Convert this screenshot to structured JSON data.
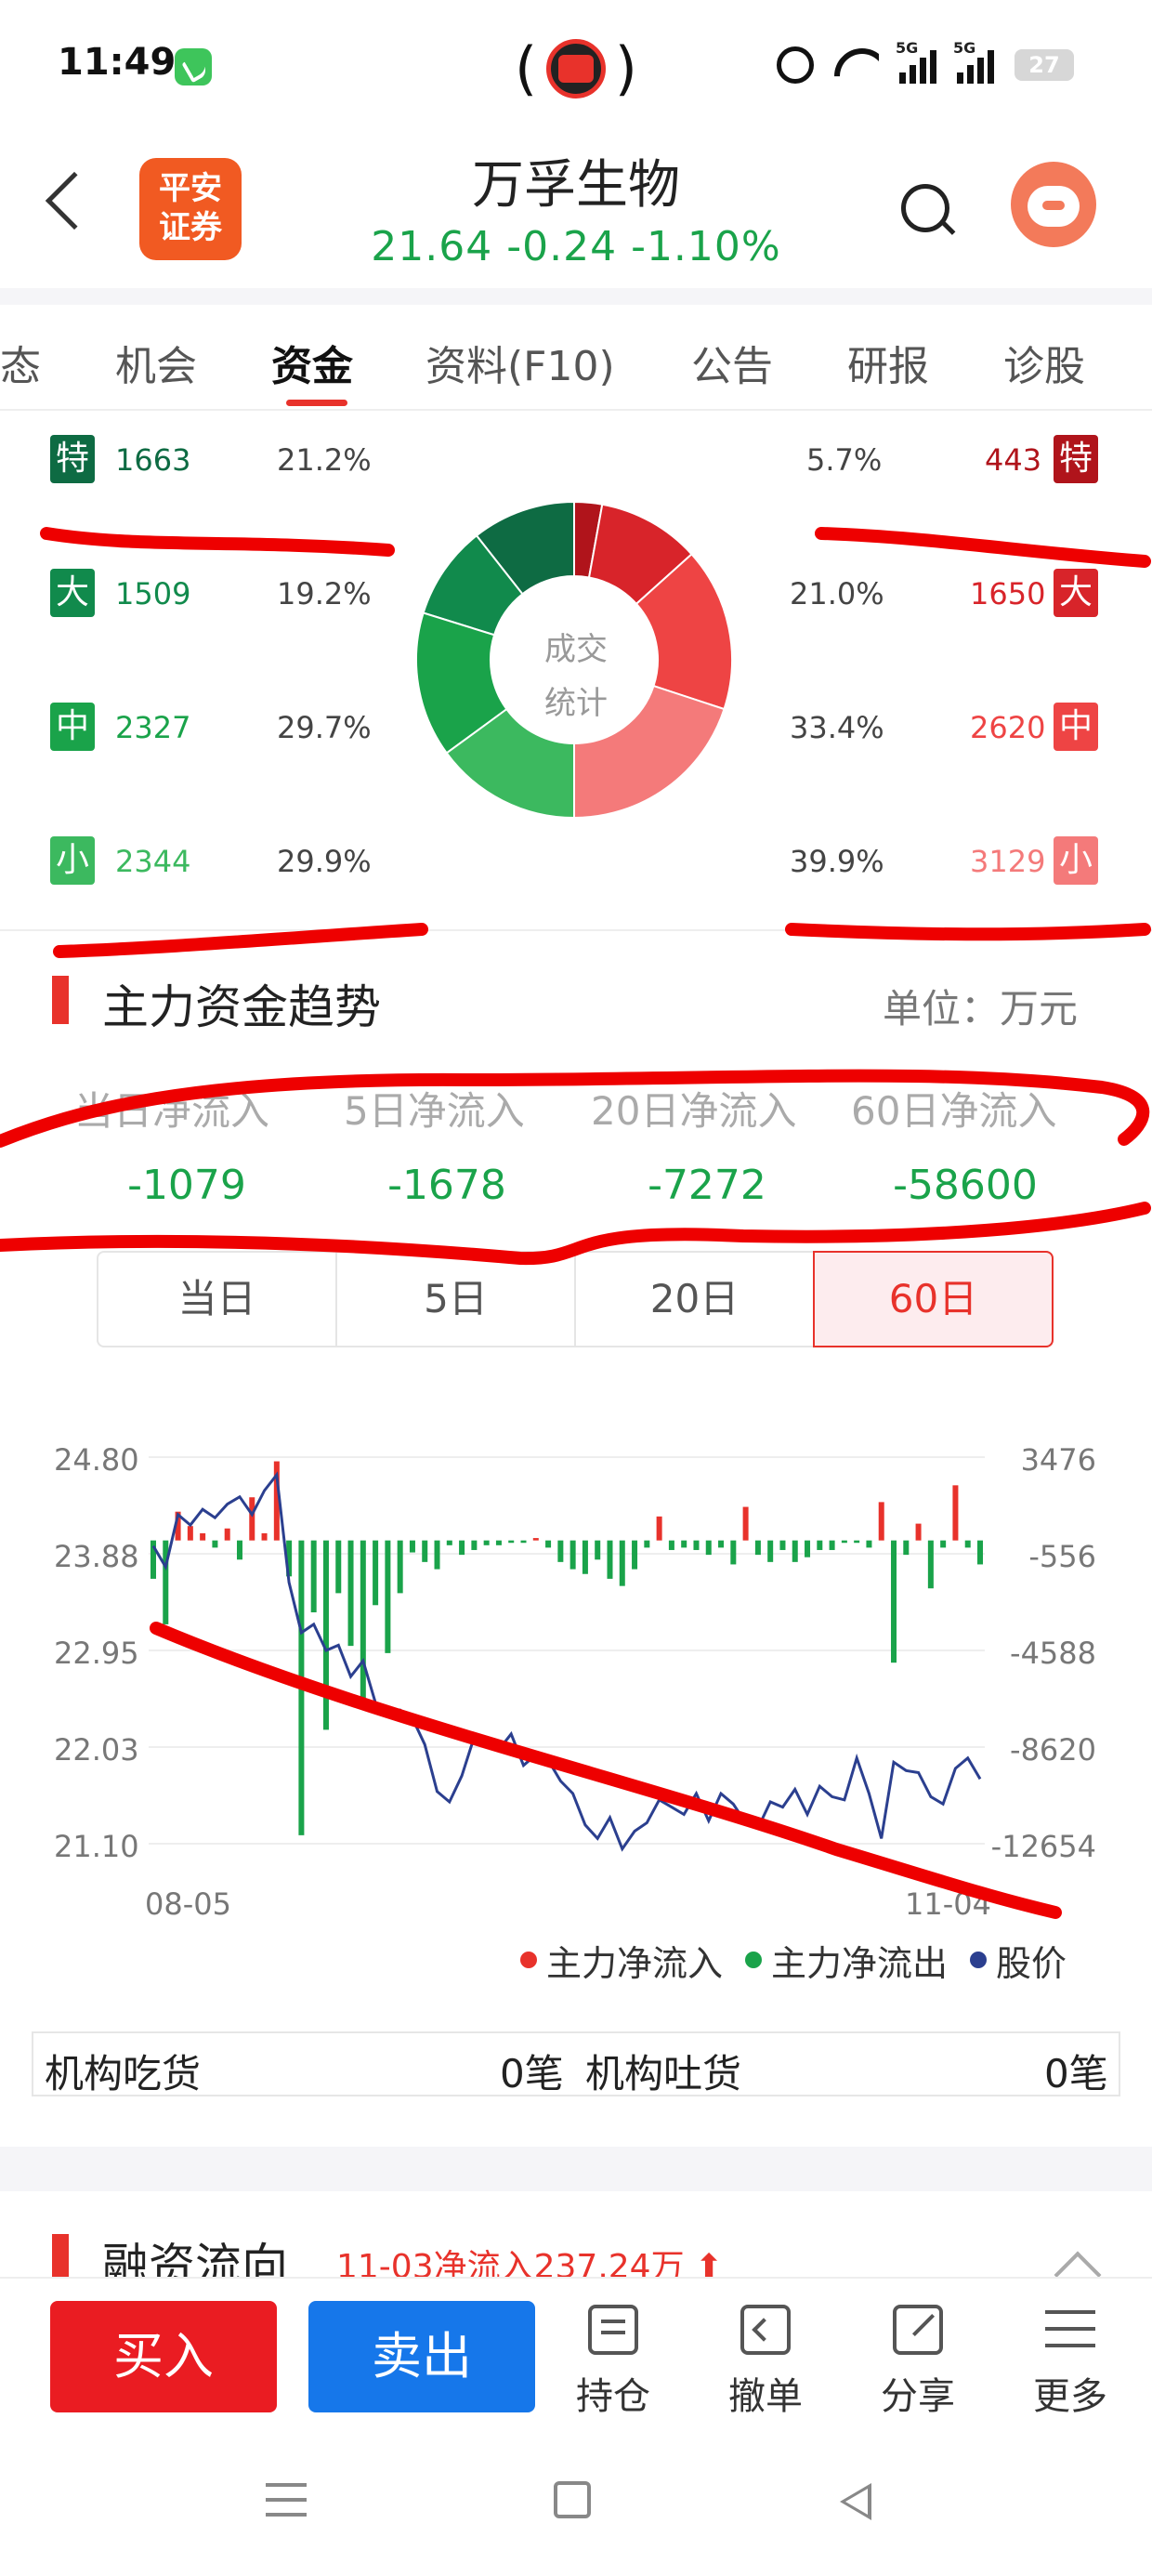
{
  "status_bar": {
    "time": "11:49",
    "center_glyph_left": "(",
    "center_glyph_right": ")",
    "signal_1": "5G",
    "signal_2": "5G",
    "battery": "27"
  },
  "header": {
    "broker_logo": "平安证券",
    "stock_name": "万孚生物",
    "quote": "21.64  -0.24  -1.10%"
  },
  "tabs": [
    {
      "label": "态"
    },
    {
      "label": "机会"
    },
    {
      "label": "资金"
    },
    {
      "label": "资料(F10)"
    },
    {
      "label": "公告"
    },
    {
      "label": "研报"
    },
    {
      "label": "诊股"
    }
  ],
  "trade_stats": {
    "donut_label": "成交统计",
    "left": [
      {
        "badge": "特",
        "count": "1663",
        "pct": "21.2%",
        "color": "#0e6b43"
      },
      {
        "badge": "大",
        "count": "1509",
        "pct": "19.2%",
        "color": "#118a4c"
      },
      {
        "badge": "中",
        "count": "2327",
        "pct": "29.7%",
        "color": "#1aa34a"
      },
      {
        "badge": "小",
        "count": "2344",
        "pct": "29.9%",
        "color": "#3cb95f"
      }
    ],
    "right": [
      {
        "badge": "特",
        "count": "443",
        "pct": "5.7%",
        "color": "#b0141b"
      },
      {
        "badge": "大",
        "count": "1650",
        "pct": "21.0%",
        "color": "#d8242a"
      },
      {
        "badge": "中",
        "count": "2620",
        "pct": "33.4%",
        "color": "#ee4444"
      },
      {
        "badge": "小",
        "count": "3129",
        "pct": "39.9%",
        "color": "#f47a7a"
      }
    ]
  },
  "main_flow": {
    "title": "主力资金趋势",
    "unit": "单位：万元",
    "labels": [
      "当日净流入",
      "5日净流入",
      "20日净流入",
      "60日净流入"
    ],
    "values": [
      "-1079",
      "-1678",
      "-7272",
      "-58600"
    ],
    "range_tabs": [
      "当日",
      "5日",
      "20日",
      "60日"
    ],
    "active_range": "60日"
  },
  "chart_data": {
    "type": "bar",
    "left_axis_ticks": [
      "24.80",
      "23.88",
      "22.95",
      "22.03",
      "21.10"
    ],
    "right_axis_ticks": [
      "3476",
      "-556",
      "-4588",
      "-8620",
      "-12654"
    ],
    "x_ticks": [
      "08-05",
      "11-04"
    ],
    "legend": [
      "主力净流入",
      "主力净流出",
      "股价"
    ],
    "flow_values": [
      -1600,
      -3500,
      1200,
      600,
      300,
      -300,
      500,
      -800,
      1800,
      300,
      3300,
      -1500,
      -12300,
      -3000,
      -7900,
      -2200,
      -4400,
      -7000,
      -2700,
      -4700,
      -2200,
      -500,
      -900,
      -1200,
      -200,
      -600,
      -400,
      -200,
      -200,
      -100,
      -100,
      100,
      -300,
      -900,
      -1200,
      -1400,
      -800,
      -1600,
      -1900,
      -1200,
      -300,
      1000,
      -400,
      -300,
      -400,
      -600,
      -300,
      -1000,
      1400,
      -600,
      -900,
      -400,
      -900,
      -700,
      -400,
      -400,
      -100,
      -100,
      -300,
      1600,
      -5100,
      -600,
      700,
      -2000,
      -300,
      2300,
      -300,
      -1000
    ],
    "price_values": [
      23.95,
      23.75,
      24.25,
      24.15,
      24.3,
      24.22,
      24.35,
      24.42,
      24.25,
      24.48,
      24.63,
      23.6,
      23.12,
      23.2,
      22.95,
      23.0,
      22.7,
      22.85,
      22.45,
      22.35,
      22.38,
      22.3,
      22.05,
      21.6,
      21.5,
      21.75,
      22.12,
      22.05,
      22.0,
      22.15,
      21.85,
      21.95,
      21.9,
      21.7,
      21.58,
      21.28,
      21.15,
      21.35,
      21.05,
      21.22,
      21.3,
      21.52,
      21.45,
      21.38,
      21.58,
      21.32,
      21.58,
      21.48,
      21.3,
      21.25,
      21.5,
      21.45,
      21.62,
      21.38,
      21.65,
      21.55,
      21.52,
      21.92,
      21.58,
      21.15,
      21.88,
      21.8,
      21.78,
      21.55,
      21.48,
      21.82,
      21.92,
      21.72
    ]
  },
  "institutional": {
    "absorb_label": "机构吃货",
    "absorb_value": "0笔",
    "dump_label": "机构吐货",
    "dump_value": "0笔"
  },
  "margin": {
    "title": "融资流向",
    "note": "11-03净流入237.24万"
  },
  "toolbar": {
    "buy": "买入",
    "sell": "卖出",
    "items": [
      "持仓",
      "撤单",
      "分享",
      "更多"
    ]
  },
  "colors": {
    "red": "#e8322b",
    "green": "#1aa34a",
    "price_line": "#2b3f8f",
    "annotation": "#ee0000"
  }
}
